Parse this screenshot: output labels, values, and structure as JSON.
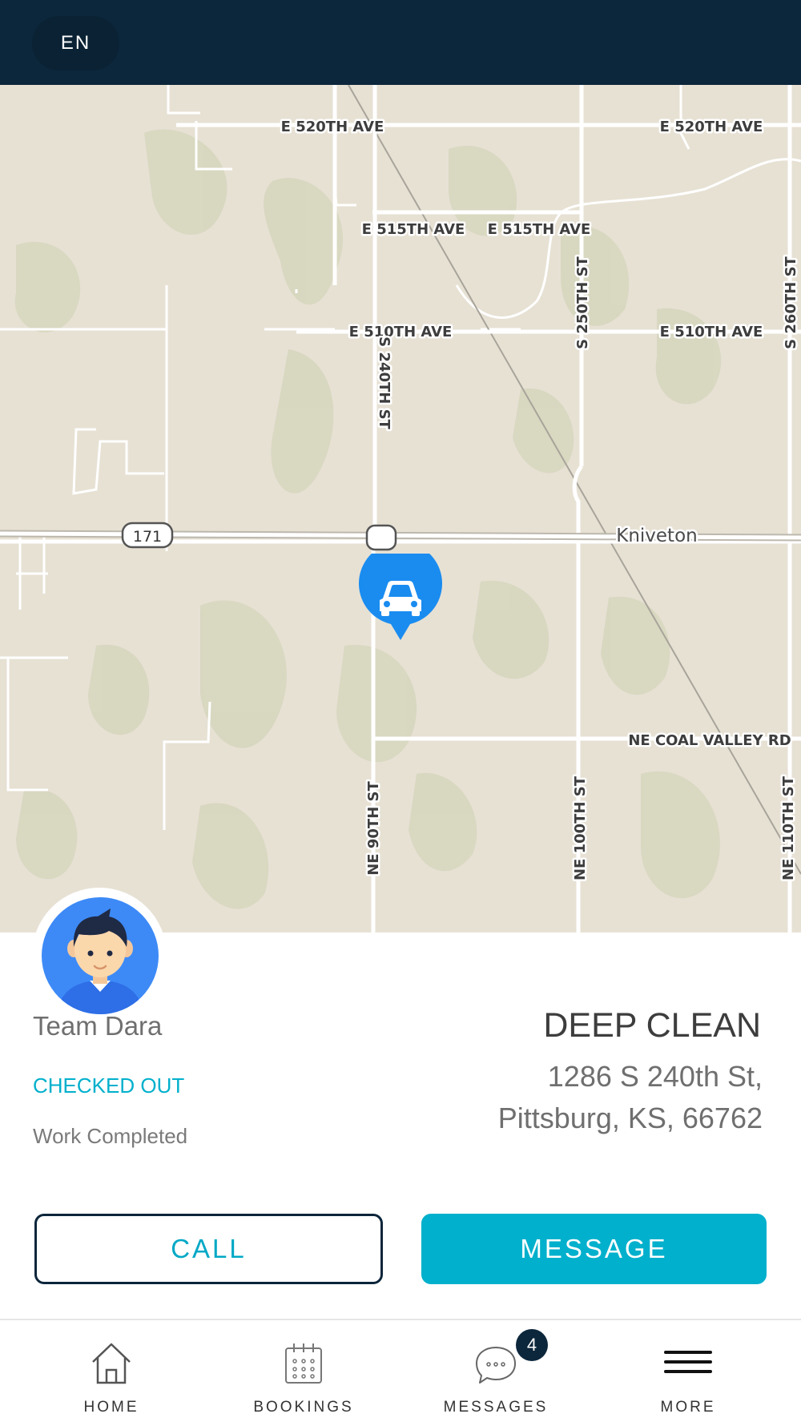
{
  "header": {
    "language": "EN"
  },
  "map": {
    "roads": {
      "e520_left": "E 520TH AVE",
      "e520_right": "E 520TH AVE",
      "e515_left": "E 515TH AVE",
      "e515_right": "E 515TH AVE",
      "e510_left": "E 510TH AVE",
      "e510_right": "E 510TH AVE",
      "s240": "S 240TH ST",
      "s250": "S 250TH ST",
      "s260": "S 260TH ST",
      "hwy171": "171",
      "coal_valley": "NE COAL VALLEY RD",
      "ne90": "NE 90TH ST",
      "ne100": "NE 100TH ST",
      "ne110": "NE 110TH ST"
    },
    "town": "Kniveton",
    "marker_icon": "car-icon"
  },
  "booking": {
    "team_name": "Team Dara",
    "status": "CHECKED OUT",
    "status_detail": "Work Completed",
    "service": "DEEP CLEAN",
    "address_line1": "1286 S 240th St,",
    "address_line2": "Pittsburg, KS, 66762"
  },
  "actions": {
    "call": "CALL",
    "message": "MESSAGE"
  },
  "nav": {
    "items": [
      {
        "label": "HOME",
        "icon": "home-icon"
      },
      {
        "label": "BOOKINGS",
        "icon": "calendar-icon"
      },
      {
        "label": "MESSAGES",
        "icon": "chat-icon"
      },
      {
        "label": "MORE",
        "icon": "menu-icon"
      }
    ],
    "messages_badge": "4"
  },
  "colors": {
    "header_bg": "#0c263b",
    "accent": "#00b0cc",
    "marker": "#1a8cf0",
    "map_bg": "#e7e1d4"
  }
}
